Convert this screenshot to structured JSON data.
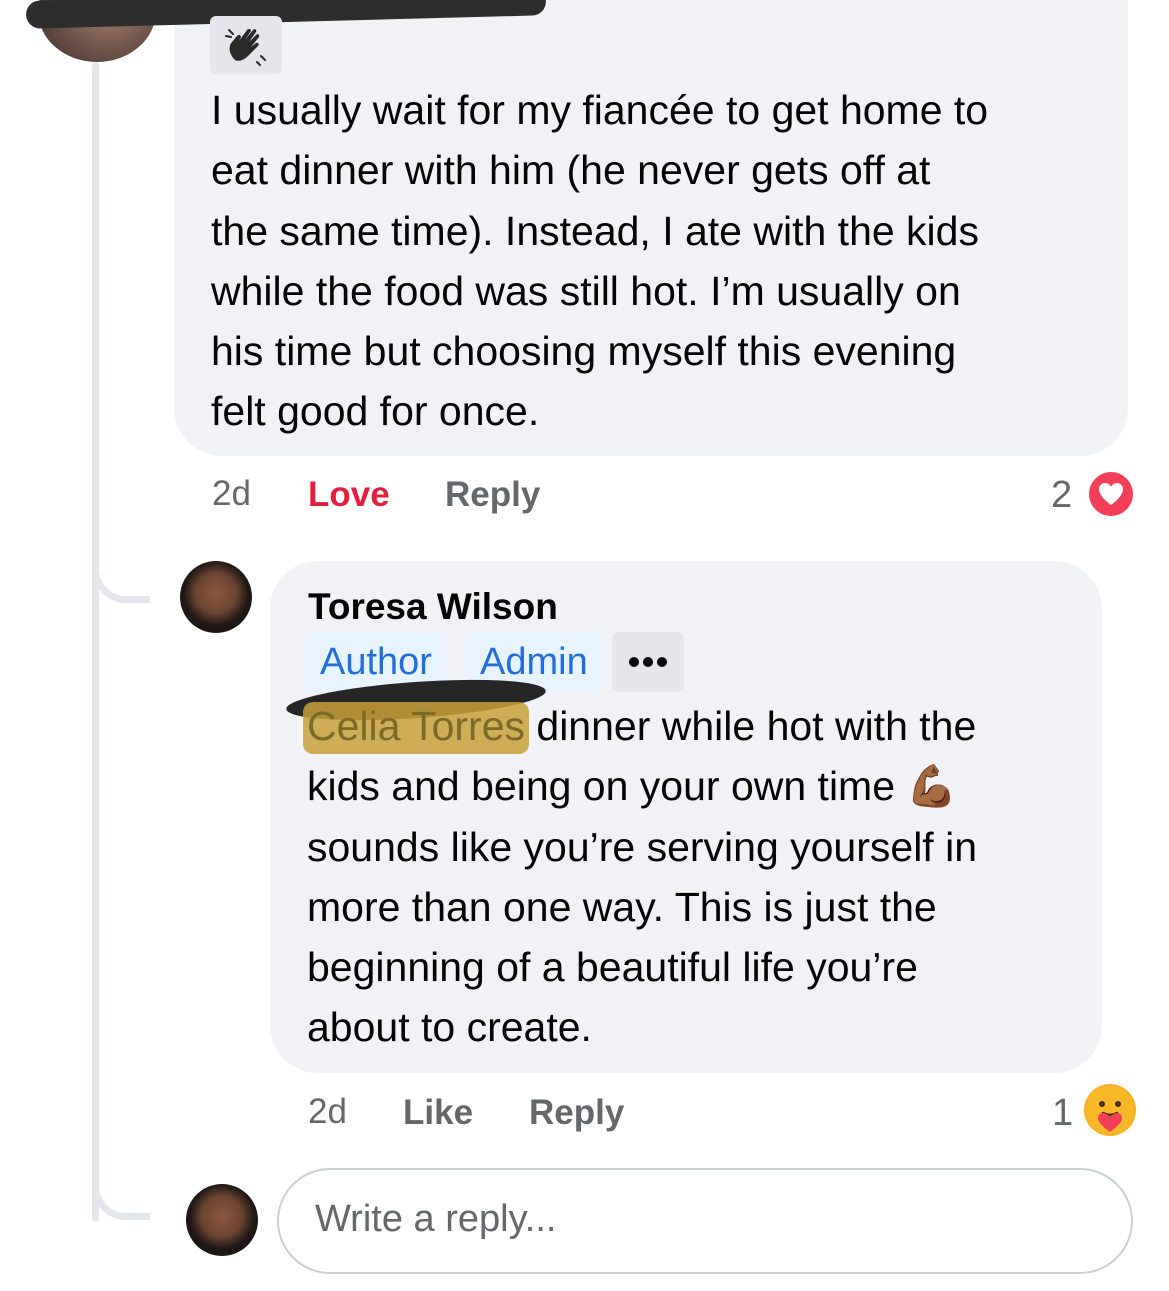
{
  "comment_1": {
    "text": "I usually wait for my fiancée to get home to eat dinner with him (he never gets off at the same time). Instead, I ate with the kids while the food was still hot. I’m usually on his time but choosing myself this evening felt good for once.",
    "lines": [
      "I usually wait for my fiancée to get home to",
      "eat dinner with him (he never gets off at",
      "the same time). Instead, I ate with the kids",
      "while the food was still hot. I’m usually on",
      "his time but choosing myself this evening",
      "felt good for once."
    ],
    "badge_icon": "waving-hand-icon",
    "time": "2d",
    "reaction_label": "Love",
    "reply_label": "Reply",
    "reaction_count": "2",
    "reaction_icon": "love-reaction-icon"
  },
  "comment_2": {
    "author": "Toresa Wilson",
    "badges": [
      "Author",
      "Admin"
    ],
    "more_icon": "more-options-icon",
    "tagged_name": "Celia Torres",
    "lines": [
      " dinner while hot with the",
      "kids and being on your own time",
      "sounds like you’re serving yourself in",
      "more than one way. This is just the",
      "beginning of a beautiful life you’re",
      "about to create."
    ],
    "inline_emoji": "💪🏾",
    "time": "2d",
    "like_label": "Like",
    "reply_label": "Reply",
    "reaction_count": "1",
    "reaction_icon": "care-reaction-icon"
  },
  "reply_composer": {
    "placeholder": "Write a reply..."
  },
  "colors": {
    "bubble_bg": "#f0f2f5",
    "love_red": "#e41e3f",
    "badge_blue": "#216fdb",
    "badge_bg": "#e7f3ff",
    "meta_gray": "#65676b"
  }
}
